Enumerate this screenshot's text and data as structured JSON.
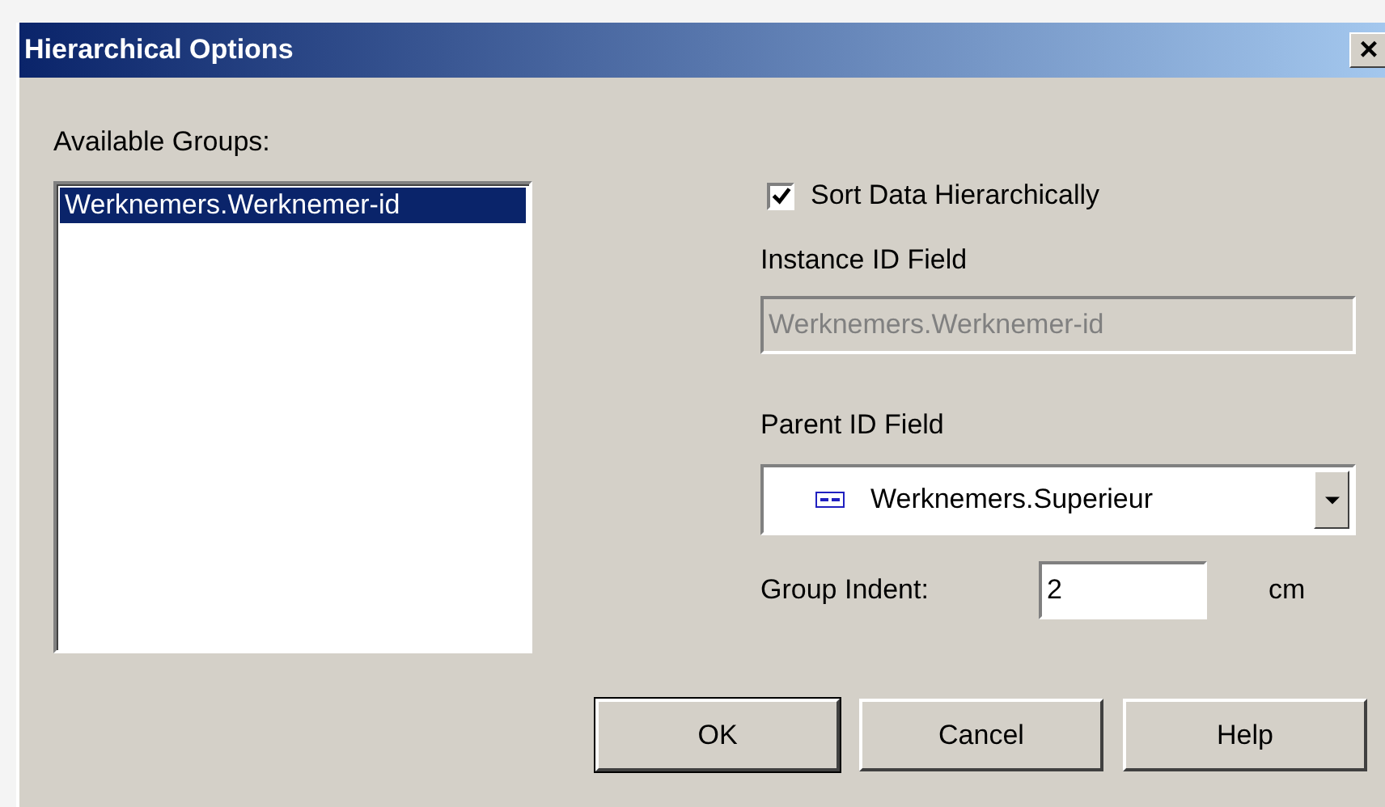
{
  "window": {
    "title": "Hierarchical Options",
    "close": "×"
  },
  "groups": {
    "label": "Available Groups:",
    "items": [
      {
        "text": "Werknemers.Werknemer-id",
        "selected": true
      }
    ]
  },
  "sort_hierarchically": {
    "label": "Sort Data Hierarchically",
    "checked": true
  },
  "instance_id_field": {
    "label": "Instance ID Field",
    "value": "Werknemers.Werknemer-id",
    "disabled": true
  },
  "parent_id_field": {
    "label": "Parent ID Field",
    "value": "Werknemers.Superieur"
  },
  "group_indent": {
    "label": "Group Indent:",
    "value": "2",
    "unit": "cm"
  },
  "buttons": [
    {
      "label": "OK",
      "default": true
    },
    {
      "label": "Cancel",
      "default": false
    },
    {
      "label": "Help",
      "default": false
    }
  ]
}
